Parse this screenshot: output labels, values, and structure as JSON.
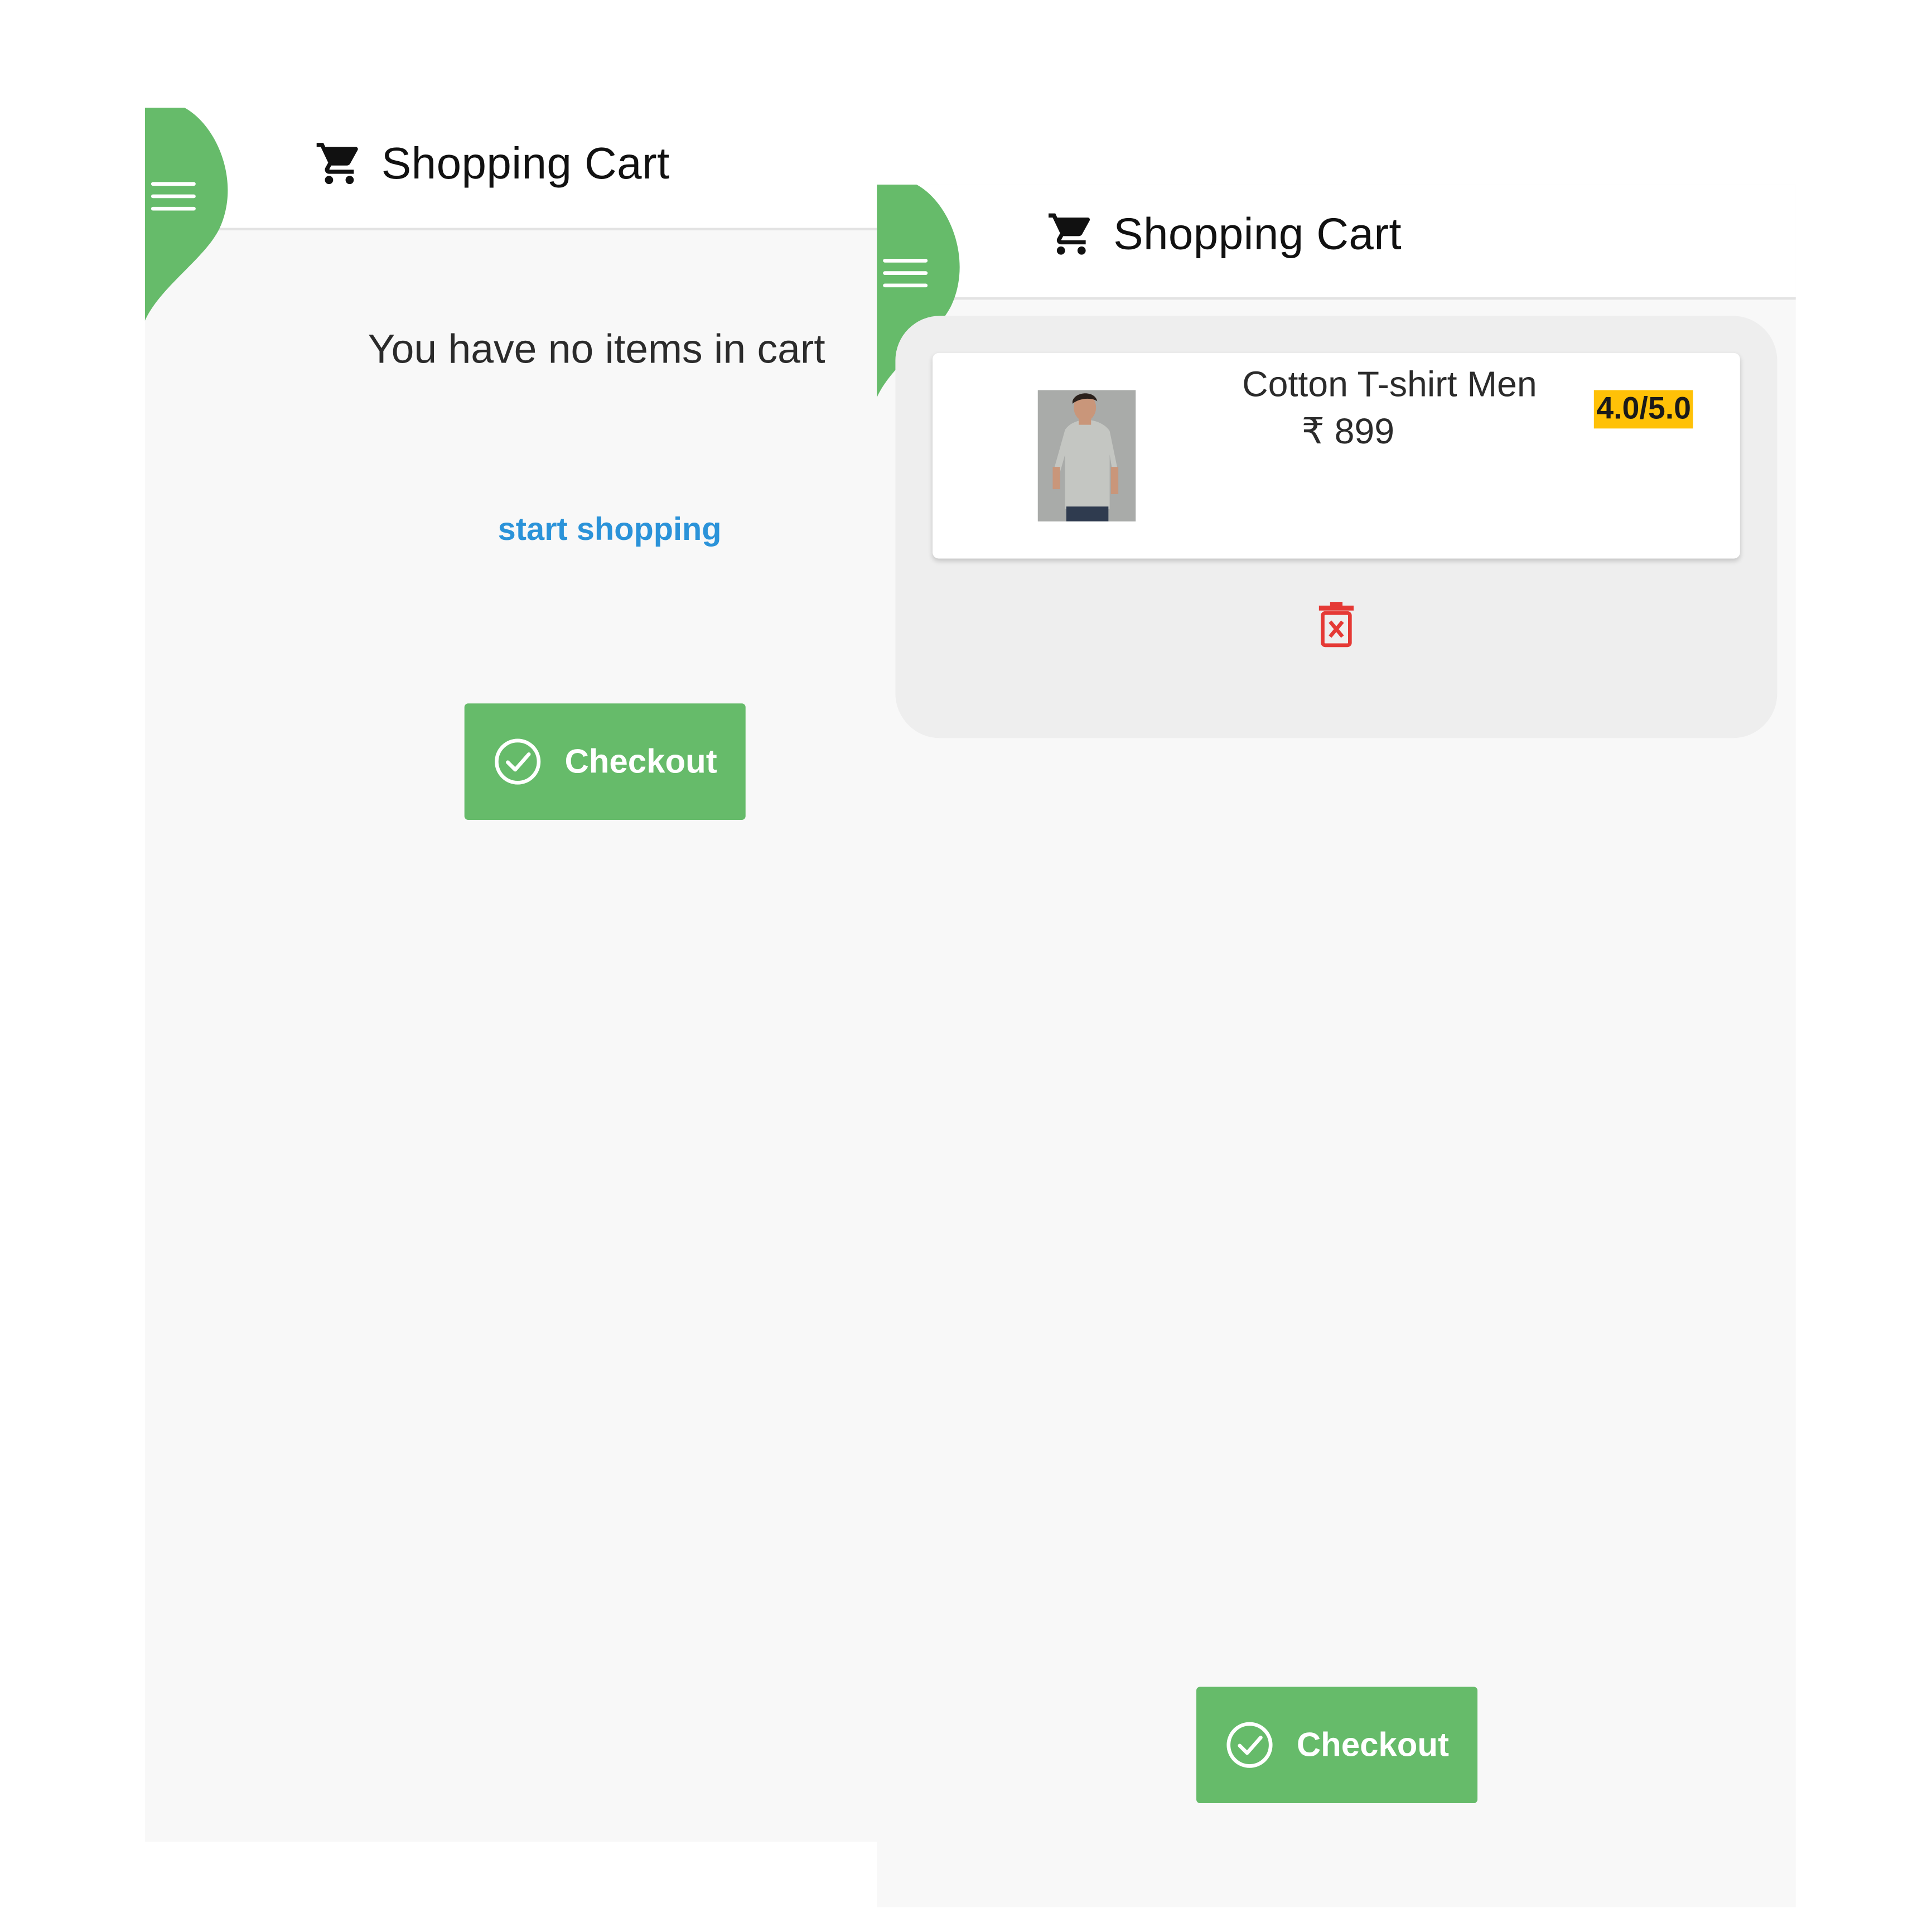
{
  "theme": {
    "accent": "#66bb6a",
    "link": "#2b93d9",
    "rating_bg": "#ffc107",
    "delete": "#e53935"
  },
  "screens": [
    {
      "app_bar": {
        "menu_icon": "hamburger-menu-icon",
        "cart_icon": "shopping-cart-icon",
        "title": "Shopping Cart"
      },
      "empty_message": "You have no items in cart",
      "start_shopping_link": "start shopping",
      "checkout": {
        "icon": "check-circle-icon",
        "label": "Checkout"
      }
    },
    {
      "app_bar": {
        "menu_icon": "hamburger-menu-icon",
        "cart_icon": "shopping-cart-icon",
        "title": "Shopping Cart"
      },
      "cart_items": [
        {
          "image": "product-photo",
          "name": "Cotton T-shirt Men",
          "price": "₹ 899",
          "rating": "4.0/5.0"
        }
      ],
      "delete_icon": "delete-forever-icon",
      "checkout": {
        "icon": "check-circle-icon",
        "label": "Checkout"
      }
    }
  ]
}
